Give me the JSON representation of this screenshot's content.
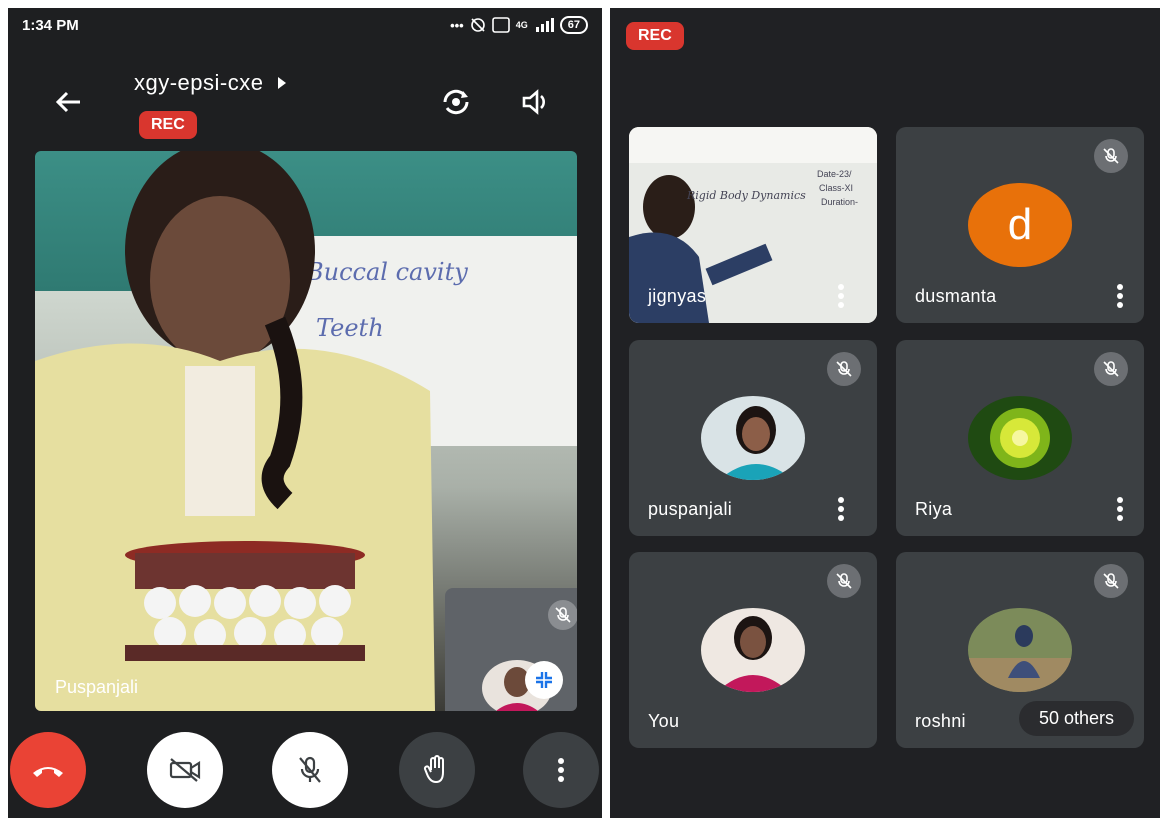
{
  "status_bar": {
    "time": "1:34 PM",
    "network_label": "4G",
    "battery": "67"
  },
  "call": {
    "meeting_code": "xgy-epsi-cxe",
    "rec_label": "REC",
    "main_speaker_name": "Puspanjali",
    "board_line1": "Buccal cavity",
    "board_line2": "Teeth"
  },
  "controls": [
    {
      "name": "end-call",
      "icon": "phone-hangup-icon"
    },
    {
      "name": "camera-off",
      "icon": "video-off-icon"
    },
    {
      "name": "mic-off",
      "icon": "mic-off-icon"
    },
    {
      "name": "raise-hand",
      "icon": "hand-icon"
    },
    {
      "name": "more",
      "icon": "more-vert-icon"
    }
  ],
  "grid": {
    "rec_label": "REC",
    "participants": [
      {
        "name": "jignyas",
        "type": "video",
        "board_line": "Rigid Body Dynamics",
        "board_note": "Date-23/",
        "board_class": "Class-XI",
        "board_duration": "Duration-"
      },
      {
        "name": "dusmanta",
        "type": "letter",
        "letter": "d",
        "letter_color": "#e8710a"
      },
      {
        "name": "puspanjali",
        "type": "photo"
      },
      {
        "name": "Riya",
        "type": "photo"
      },
      {
        "name": "You",
        "type": "photo"
      },
      {
        "name": "roshni",
        "type": "photo",
        "others_label": "50 others"
      }
    ]
  },
  "colors": {
    "rec_red": "#d9362e",
    "end_call_red": "#ea4335",
    "tile_bg": "#3c4043",
    "avatar_orange": "#e8710a"
  }
}
